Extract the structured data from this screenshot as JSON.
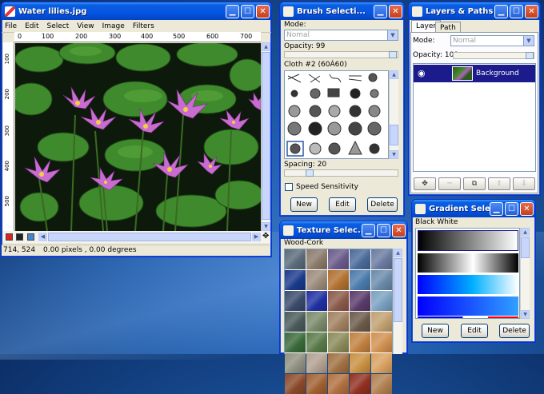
{
  "main_window": {
    "title": "Water lilies.jpg",
    "menu": [
      "File",
      "Edit",
      "Select",
      "View",
      "Image",
      "Filters"
    ],
    "ruler_h": [
      "0",
      "100",
      "200",
      "300",
      "400",
      "500",
      "600",
      "700"
    ],
    "ruler_v": [
      "100",
      "200",
      "300",
      "400",
      "500"
    ],
    "status_coords": "714, 524",
    "status_info": "0.00 pixels , 0.00 degrees"
  },
  "brush": {
    "title": "Brush Selecti...",
    "mode_label": "Mode:",
    "mode_value": "Nomal",
    "opacity_label": "Opacity: 99",
    "opacity_level": 0.99,
    "brush_name": "Cloth #2 (60Á60)",
    "spacing_label": "Spacing: 20",
    "spacing_level": 0.2,
    "speed_label": "Speed Sensitivity",
    "buttons": [
      "New",
      "Edit",
      "Delete"
    ]
  },
  "layers": {
    "title": "Layers & Paths",
    "tabs": [
      "Layer",
      "Path"
    ],
    "mode_label": "Mode:",
    "mode_value": "Nomal",
    "opacity_label": "Opacity: 100",
    "opacity_level": 1.0,
    "layer_name": "Background",
    "tool_icons": [
      "new-layer-icon",
      "delete-layer-icon",
      "duplicate-layer-icon",
      "raise-layer-icon",
      "lower-layer-icon"
    ],
    "tool_glyphs": [
      "✥",
      "─",
      "⧉",
      "⇧",
      "⇩"
    ]
  },
  "texture": {
    "title": "Texture Selec...",
    "name": "Wood-Cork",
    "colors": [
      "#5a6a7a",
      "#8a7a6a",
      "#6a5a8a",
      "#4a6a9a",
      "#6a7aa0",
      "#1a3a8a",
      "#9a8a7a",
      "#b07030",
      "#4a7aaa",
      "#6a8aaa",
      "#3a4a6a",
      "#2030a0",
      "#8a5a4a",
      "#5a3a6a",
      "#7aa0c0",
      "#4a5a5a",
      "#7a8a6a",
      "#a08060",
      "#6a5a4a",
      "#c0a070",
      "#3a6a3a",
      "#5a7a4a",
      "#8a8a5a",
      "#c08040",
      "#d09050",
      "#909080",
      "#b0a090",
      "#a07040",
      "#c89040",
      "#d8a060",
      "#8a4a2a",
      "#a06030",
      "#b07040",
      "#903020",
      "#b08050"
    ]
  },
  "gradient": {
    "title": "Gradient Sele...",
    "name": "Black White",
    "buttons": [
      "New",
      "Edit",
      "Delete"
    ]
  }
}
